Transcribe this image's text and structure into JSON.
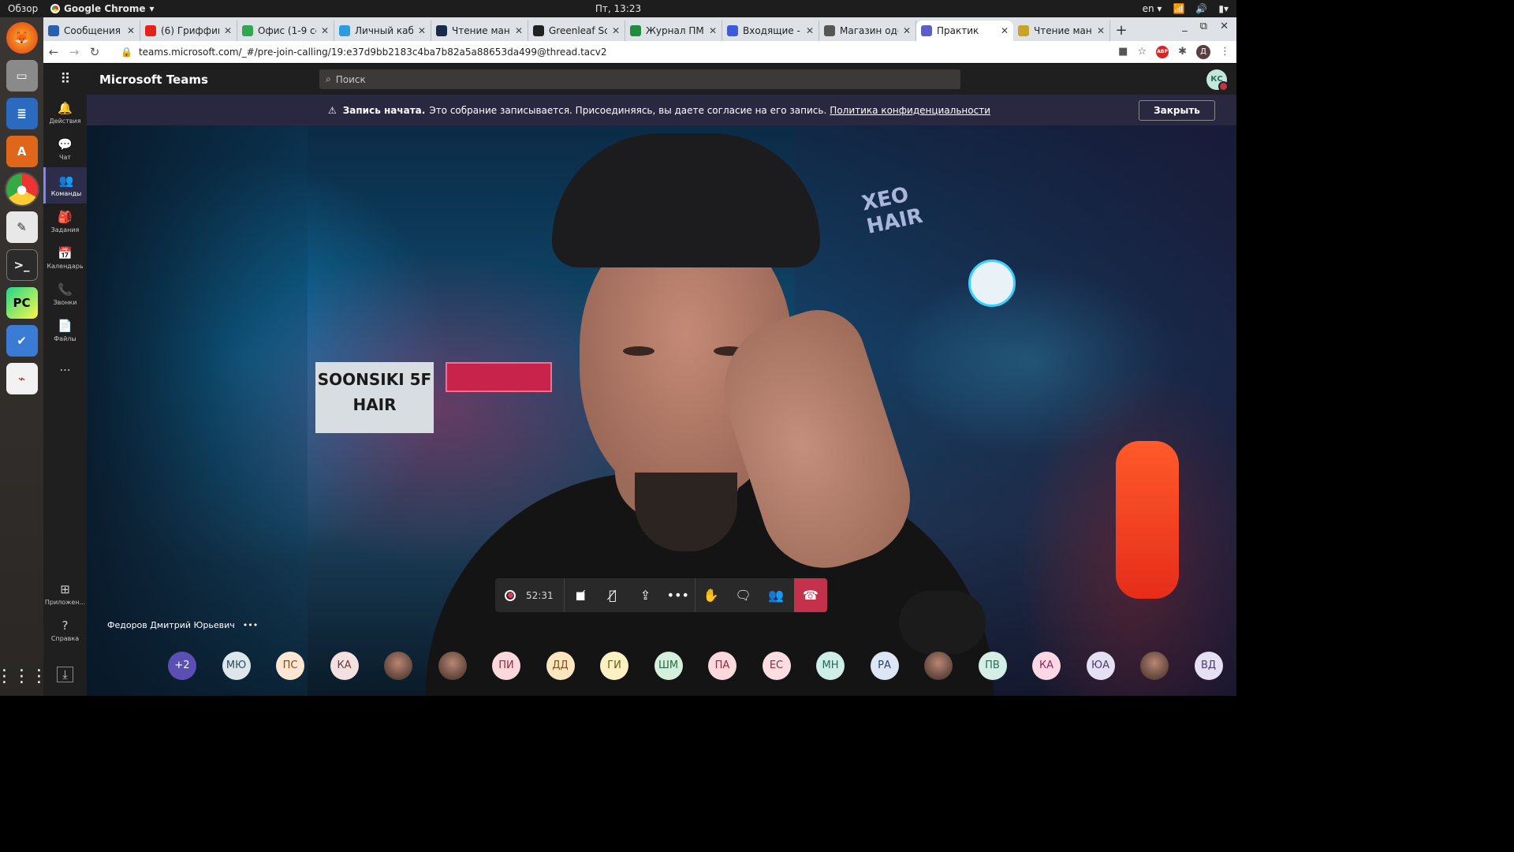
{
  "os_bar": {
    "overview": "Обзор",
    "app_name": "Google Chrome",
    "clock": "Пт, 13:23",
    "lang": "en"
  },
  "dock": {
    "apps": [
      "firefox",
      "files",
      "writer",
      "software-center",
      "chrome",
      "text-editor",
      "terminal",
      "pycharm",
      "tasks",
      "pdf-viewer"
    ]
  },
  "browser": {
    "tabs": [
      {
        "title": "Сообщения",
        "color": "#2a5fb0"
      },
      {
        "title": "(6) Гриффин",
        "color": "#e62117"
      },
      {
        "title": "Офис (1-9 се",
        "color": "#2fa84f"
      },
      {
        "title": "Личный каб",
        "color": "#2a9de0"
      },
      {
        "title": "Чтение ман",
        "color": "#1a2a4a"
      },
      {
        "title": "Greenleaf Sc",
        "color": "#222222"
      },
      {
        "title": "Журнал ПМ",
        "color": "#1e8e3e"
      },
      {
        "title": "Входящие -",
        "color": "#3d5adb"
      },
      {
        "title": "Магазин оде",
        "color": "#555555"
      },
      {
        "title": "Практик",
        "color": "#5b5fc7"
      },
      {
        "title": "Чтение ман",
        "color": "#c9a227"
      }
    ],
    "active_tab_index": 9,
    "new_tab": "+",
    "url": "teams.microsoft.com/_#/pre-join-calling/19:e37d9bb2183c4ba7b82a5a88653da499@thread.tacv2",
    "profile_initial": "Д",
    "abp_label": "ABP"
  },
  "teams": {
    "app_title": "Microsoft Teams",
    "search_placeholder": "Поиск",
    "user_initials": "КС",
    "rail": [
      {
        "label": "Действия",
        "icon": "bell-icon",
        "glyph": "🔔"
      },
      {
        "label": "Чат",
        "icon": "chat-icon",
        "glyph": "💬"
      },
      {
        "label": "Команды",
        "icon": "teams-icon",
        "glyph": "👥"
      },
      {
        "label": "Задания",
        "icon": "assignments-icon",
        "glyph": "🎒"
      },
      {
        "label": "Календарь",
        "icon": "calendar-icon",
        "glyph": "📅"
      },
      {
        "label": "Звонки",
        "icon": "phone-icon",
        "glyph": "📞"
      },
      {
        "label": "Файлы",
        "icon": "files-icon",
        "glyph": "📄"
      }
    ],
    "rail_more": "...",
    "rail_bottom": [
      {
        "label": "Приложен...",
        "icon": "apps-icon",
        "glyph": "⊞"
      },
      {
        "label": "Справка",
        "icon": "help-icon",
        "glyph": "?"
      }
    ],
    "active_rail_index": 2
  },
  "banner": {
    "bold": "Запись начата.",
    "text": "Это собрание записывается. Присоединяясь, вы даете согласие на его запись.",
    "link": "Политика конфиденциальности",
    "close": "Закрыть"
  },
  "background_signs": {
    "hair": "SOONSIKI 5F HAIR",
    "xeo": "XEO HAIR"
  },
  "call": {
    "timer": "52:31",
    "speaker_name": "Федоров Дмитрий Юрьевич",
    "speaker_more": "•••"
  },
  "participants": [
    {
      "initials": "+2",
      "bg": "#5b4fb5",
      "fg": "#ffffff"
    },
    {
      "initials": "МЮ",
      "bg": "#dde6ea",
      "fg": "#2c4a57"
    },
    {
      "initials": "ПС",
      "bg": "#fde7d2",
      "fg": "#7a4a1e"
    },
    {
      "initials": "КА",
      "bg": "#f3e0e0",
      "fg": "#6b3b3b"
    },
    {
      "initials": "",
      "bg": "",
      "fg": "",
      "photo": true
    },
    {
      "initials": "",
      "bg": "",
      "fg": "",
      "photo": true
    },
    {
      "initials": "ПИ",
      "bg": "#fbd8dd",
      "fg": "#8a2c3c"
    },
    {
      "initials": "ДД",
      "bg": "#fde6bf",
      "fg": "#7a5414"
    },
    {
      "initials": "ГИ",
      "bg": "#fdf0c2",
      "fg": "#6a5a14"
    },
    {
      "initials": "ШМ",
      "bg": "#d4f0dd",
      "fg": "#2d6a42"
    },
    {
      "initials": "ПА",
      "bg": "#fbd8dd",
      "fg": "#8a2c3c"
    },
    {
      "initials": "ЕС",
      "bg": "#fbdde2",
      "fg": "#8a2c3c"
    },
    {
      "initials": "МН",
      "bg": "#cfeee8",
      "fg": "#1f6a5c"
    },
    {
      "initials": "РА",
      "bg": "#dde6f4",
      "fg": "#2c3f6b"
    },
    {
      "initials": "",
      "bg": "",
      "fg": "",
      "photo": true
    },
    {
      "initials": "ПВ",
      "bg": "#d4f0e6",
      "fg": "#2d6a52"
    },
    {
      "initials": "КА",
      "bg": "#fbd8e4",
      "fg": "#8a2c55"
    },
    {
      "initials": "ЮА",
      "bg": "#e6e0f4",
      "fg": "#4a3b6b"
    },
    {
      "initials": "",
      "bg": "",
      "fg": "",
      "photo": true
    },
    {
      "initials": "ВД",
      "bg": "#e6e0f4",
      "fg": "#4a3b6b"
    }
  ]
}
